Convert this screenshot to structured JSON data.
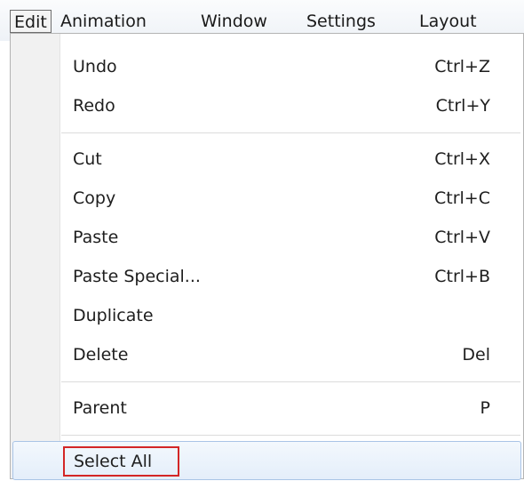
{
  "menubar": {
    "items": [
      {
        "label": "Edit",
        "active": true
      },
      {
        "label": "Animation"
      },
      {
        "label": "Window"
      },
      {
        "label": "Settings"
      },
      {
        "label": "Layout"
      }
    ]
  },
  "edit_menu": {
    "groups": [
      [
        {
          "label": "Undo",
          "shortcut": "Ctrl+Z"
        },
        {
          "label": "Redo",
          "shortcut": "Ctrl+Y"
        }
      ],
      [
        {
          "label": "Cut",
          "shortcut": "Ctrl+X"
        },
        {
          "label": "Copy",
          "shortcut": "Ctrl+C"
        },
        {
          "label": "Paste",
          "shortcut": "Ctrl+V"
        },
        {
          "label": "Paste Special...",
          "shortcut": "Ctrl+B"
        },
        {
          "label": "Duplicate",
          "shortcut": ""
        },
        {
          "label": "Delete",
          "shortcut": "Del"
        }
      ],
      [
        {
          "label": "Parent",
          "shortcut": "P"
        }
      ],
      [
        {
          "label": "Select All",
          "shortcut": "",
          "highlighted": true
        }
      ]
    ]
  },
  "colors": {
    "highlight_border": "#d32626",
    "hover_border": "#a9c4e6"
  }
}
